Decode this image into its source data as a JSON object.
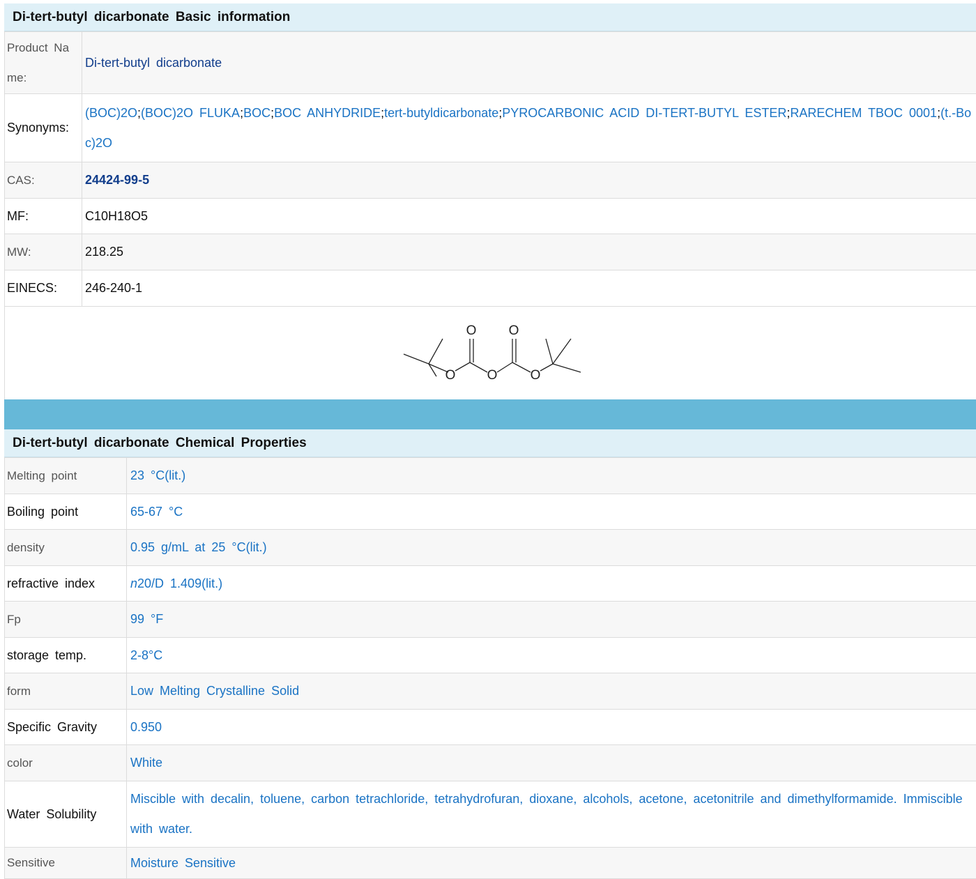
{
  "basic": {
    "title": "Di-tert-butyl dicarbonate Basic information",
    "product_name_label": "Product Name:",
    "product_name": "Di-tert-butyl dicarbonate",
    "synonyms_label": "Synonyms:",
    "synonyms": [
      "(BOC)2O",
      "(BOC)2O FLUKA",
      "BOC",
      "BOC ANHYDRIDE",
      "tert-butyldicarbonate",
      "PYROCARBONIC ACID DI-TERT-BUTYL ESTER",
      "RARECHEM TBOC 0001",
      "(t.-Boc)2O"
    ],
    "cas_label": "CAS:",
    "cas": "24424-99-5",
    "mf_label": "MF:",
    "mf": "C10H18O5",
    "mw_label": "MW:",
    "mw": "218.25",
    "einecs_label": "EINECS:",
    "einecs": "246-240-1",
    "structure_atoms": [
      "O",
      "O",
      "O",
      "O",
      "O"
    ]
  },
  "chem": {
    "title": "Di-tert-butyl dicarbonate Chemical Properties",
    "rows": [
      {
        "label": "Melting point",
        "value": "23 °C(lit.)"
      },
      {
        "label": "Boiling point",
        "value": "65-67 °C"
      },
      {
        "label": "density",
        "value": "0.95 g/mL at 25 °C(lit.)"
      },
      {
        "label": "refractive index",
        "value_italic": "n",
        "value": "20/D 1.409(lit.)"
      },
      {
        "label": "Fp",
        "value": "99 °F"
      },
      {
        "label": "storage temp.",
        "value": "2-8°C"
      },
      {
        "label": "form",
        "value": "Low Melting Crystalline Solid"
      },
      {
        "label": "Specific Gravity",
        "value": "0.950"
      },
      {
        "label": "color",
        "value": "White"
      },
      {
        "label": "Water Solubility",
        "value": "Miscible with decalin, toluene, carbon tetrachloride, tetrahydrofuran, dioxane, alcohols, acetone, acetonitrile and dimethylformamide. Immiscible with water."
      },
      {
        "label": "Sensitive",
        "value": "Moisture Sensitive"
      }
    ]
  },
  "colors": {
    "link": "#1a73c4",
    "link_dark": "#123e8c",
    "header_bg": "#dff0f7",
    "band": "#66b8d8"
  }
}
